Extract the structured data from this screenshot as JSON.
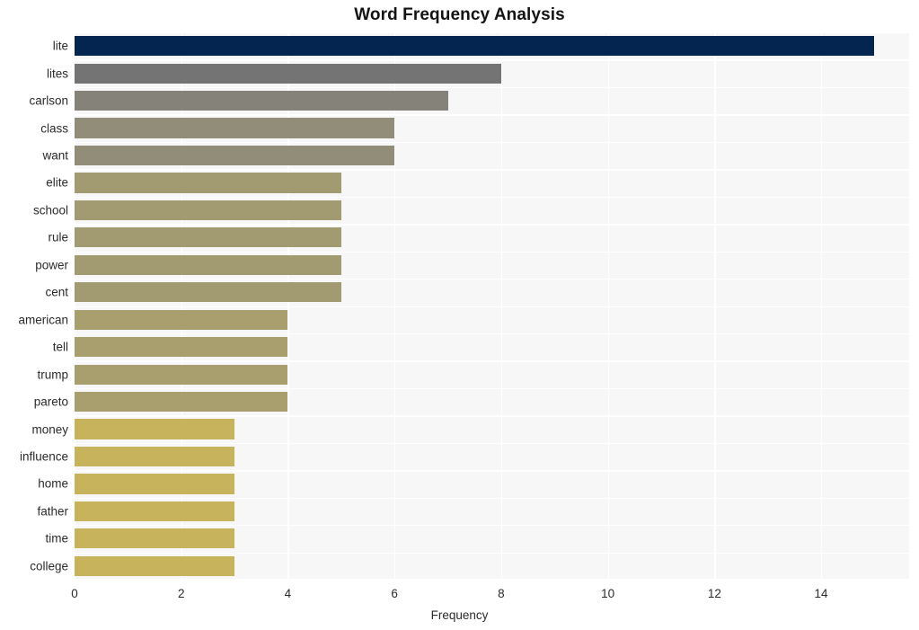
{
  "chart_data": {
    "type": "bar",
    "orientation": "horizontal",
    "title": "Word Frequency Analysis",
    "xlabel": "Frequency",
    "ylabel": "",
    "categories": [
      "lite",
      "lites",
      "carlson",
      "class",
      "want",
      "elite",
      "school",
      "rule",
      "power",
      "cent",
      "american",
      "tell",
      "trump",
      "pareto",
      "money",
      "influence",
      "home",
      "father",
      "time",
      "college"
    ],
    "values": [
      15,
      8,
      7,
      6,
      6,
      5,
      5,
      5,
      5,
      5,
      4,
      4,
      4,
      4,
      3,
      3,
      3,
      3,
      3,
      3
    ],
    "bar_colors": [
      "#042550",
      "#747474",
      "#85827a",
      "#918d79",
      "#918d79",
      "#a29a71",
      "#a29a71",
      "#a29a71",
      "#a29a71",
      "#a29a71",
      "#a99f6e",
      "#a99f6e",
      "#a99f6e",
      "#a99f6e",
      "#c6b35c",
      "#c6b35c",
      "#c6b35c",
      "#c6b35c",
      "#c6b35c",
      "#c6b35c"
    ],
    "xticks": [
      0,
      2,
      4,
      6,
      8,
      10,
      12,
      14
    ],
    "xtick_labels": [
      "0",
      "2",
      "4",
      "6",
      "8",
      "10",
      "12",
      "14"
    ],
    "xlim": [
      0,
      15.65
    ],
    "grid": "vertical-only",
    "legend": "none",
    "plot_background": "#f7f7f7",
    "gridline_color": "#ffffff",
    "figure_background": "#ffffff",
    "title_color": "#141414",
    "tick_label_color": "#2b2b2b"
  }
}
